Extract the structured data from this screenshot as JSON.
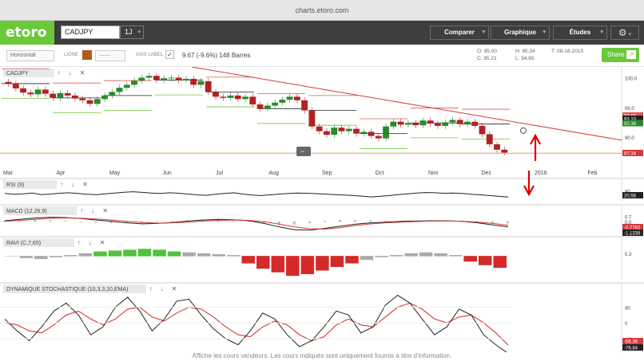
{
  "browser": {
    "url": "charts.etoro.com"
  },
  "header": {
    "logo": "etoro",
    "symbol": "CADJPY",
    "timeframe": "1J",
    "buttons": [
      "Comparer",
      "Graphique",
      "Études"
    ],
    "settings_icon": "gear-icon"
  },
  "toolbar": {
    "orientation": "Horizontal",
    "line_label": "LIGNE",
    "axis_label": "AXIS LABEL",
    "line_color": "#b35a1a",
    "stats": "9.67 (-9.6%) 148 Barres",
    "ohlc": {
      "o": "95.00",
      "h": "95.34",
      "t": "08-18-2015",
      "c": "95.21",
      "l": "94.65"
    },
    "ohlc_letters": {
      "o": "O:",
      "h": "H:",
      "t": "T:",
      "c": "C:",
      "l": "L:"
    },
    "share": "Share"
  },
  "chart_data": [
    {
      "type": "candlestick",
      "title": "CADJPY",
      "x_labels": [
        "Mar",
        "Apr",
        "May",
        "Jun",
        "Jul",
        "Aug",
        "Sep",
        "Oct",
        "Nov",
        "Dec",
        "2016",
        "Feb"
      ],
      "ylim": [
        86,
        101
      ],
      "y_ticks": [
        {
          "v": 100,
          "t": "100.0"
        },
        {
          "v": 95,
          "t": "95.0"
        },
        {
          "v": 90,
          "t": "90.0"
        }
      ],
      "closes": [
        99.0,
        98.2,
        97.5,
        97.2,
        98.0,
        97.3,
        96.6,
        97.4,
        97.0,
        96.5,
        96.2,
        95.6,
        96.4,
        97.0,
        97.6,
        98.3,
        98.8,
        99.5,
        100.0,
        100.3,
        99.6,
        99.9,
        100.0,
        99.6,
        99.8,
        98.8,
        99.4,
        97.6,
        96.8,
        96.6,
        97.0,
        96.4,
        96.8,
        95.5,
        94.8,
        95.3,
        95.8,
        96.3,
        96.8,
        96.2,
        94.5,
        91.8,
        91.0,
        90.4,
        91.6,
        91.0,
        91.4,
        90.6,
        90.9,
        90.2,
        89.8,
        91.8,
        92.6,
        92.1,
        92.4,
        92.0,
        92.8,
        92.3,
        91.9,
        92.5,
        92.9,
        92.2,
        92.6,
        91.9,
        90.5,
        88.8,
        87.9,
        87.4
      ],
      "annotations": [
        "93.66",
        "93.10",
        "92.36",
        "87.34"
      ]
    },
    {
      "type": "line",
      "title": "RSI (9)",
      "ylim": [
        0,
        100
      ],
      "y_ticks": [
        {
          "v": 80,
          "t": "80"
        }
      ],
      "last": "20.56",
      "values": [
        55,
        48,
        52,
        60,
        45,
        50,
        58,
        62,
        55,
        48,
        44,
        52,
        60,
        68,
        72,
        66,
        60,
        55,
        62,
        58,
        50,
        42,
        38,
        48,
        55,
        62,
        50,
        40,
        35,
        42,
        50,
        56,
        60,
        58,
        54,
        50,
        45,
        40,
        36,
        30,
        22,
        28,
        35,
        44,
        52,
        60,
        65,
        62,
        58,
        60,
        55,
        48,
        42,
        35,
        28,
        21
      ]
    },
    {
      "type": "line",
      "title": "MACD (12,26,9)",
      "ylim": [
        -1.4,
        0.9
      ],
      "y_ticks": [
        {
          "v": 0.7,
          "t": "0.7"
        },
        {
          "v": 0,
          "t": "0.0"
        }
      ],
      "last": [
        "-0.7782",
        "-1.1339"
      ],
      "macd": [
        0.1,
        0.3,
        0.5,
        0.6,
        0.55,
        0.4,
        0.2,
        0.0,
        -0.2,
        -0.35,
        -0.3,
        -0.15,
        0.05,
        0.2,
        0.3,
        0.25,
        0.1,
        -0.3,
        -0.8,
        -1.2,
        -1.25,
        -1.0,
        -0.7,
        -0.4,
        -0.2,
        -0.1,
        0.0,
        0.05,
        0.1,
        0.08,
        0.0,
        -0.2,
        -0.5,
        -0.78
      ],
      "signal": [
        0.0,
        0.15,
        0.3,
        0.45,
        0.5,
        0.45,
        0.35,
        0.2,
        0.0,
        -0.15,
        -0.25,
        -0.2,
        -0.1,
        0.05,
        0.15,
        0.2,
        0.15,
        -0.05,
        -0.4,
        -0.8,
        -1.05,
        -1.1,
        -0.9,
        -0.6,
        -0.35,
        -0.2,
        -0.1,
        -0.02,
        0.05,
        0.07,
        0.03,
        -0.1,
        -0.3,
        -0.55
      ]
    },
    {
      "type": "bar",
      "title": "RAVI (C,7,65)",
      "ylim": [
        -2.5,
        1.0
      ],
      "y_ticks": [
        {
          "v": 0.3,
          "t": "0.3"
        }
      ],
      "values": [
        0.0,
        -0.2,
        -0.3,
        -0.1,
        0.1,
        0.3,
        0.5,
        0.6,
        0.7,
        0.8,
        0.7,
        0.5,
        0.4,
        0.3,
        0.2,
        0.1,
        -0.8,
        -1.4,
        -1.8,
        -2.2,
        -2.0,
        -1.6,
        -1.2,
        -0.8,
        -0.4,
        -0.1,
        0.1,
        0.3,
        0.4,
        0.3,
        0.1,
        -0.6,
        -1.0,
        -1.3
      ]
    },
    {
      "type": "line",
      "title": "DYNAMIQUE STOCHASTIQUE (10,3,3,10,EMA)",
      "ylim": [
        -70,
        75
      ],
      "y_ticks": [
        {
          "v": 40,
          "t": "40"
        },
        {
          "v": 0,
          "t": "0"
        },
        {
          "v": -40,
          "t": "-40"
        }
      ],
      "last": [
        "-56.36",
        "-76.84"
      ],
      "k": [
        10,
        -20,
        -45,
        -10,
        30,
        50,
        20,
        -30,
        -10,
        40,
        65,
        30,
        -20,
        10,
        55,
        60,
        20,
        -15,
        -40,
        -55,
        -20,
        25,
        10,
        -30,
        -60,
        -45,
        -10,
        30,
        20,
        -25,
        -10,
        45,
        70,
        50,
        10,
        -30,
        -10,
        35,
        20,
        -30,
        -55,
        -77
      ],
      "d": [
        0,
        -5,
        -20,
        -25,
        -5,
        20,
        30,
        10,
        -5,
        10,
        35,
        40,
        15,
        5,
        25,
        40,
        35,
        15,
        -10,
        -30,
        -35,
        -10,
        5,
        -5,
        -30,
        -45,
        -35,
        -5,
        10,
        -5,
        -10,
        15,
        40,
        50,
        35,
        10,
        0,
        15,
        20,
        0,
        -25,
        -56
      ]
    }
  ],
  "panel_buttons": {
    "up": "↑",
    "down": "↓",
    "close": "✕"
  },
  "footer": "Affiche les cours vendeurs. Les cours indiqués sont uniquement fournis à titre d'information."
}
